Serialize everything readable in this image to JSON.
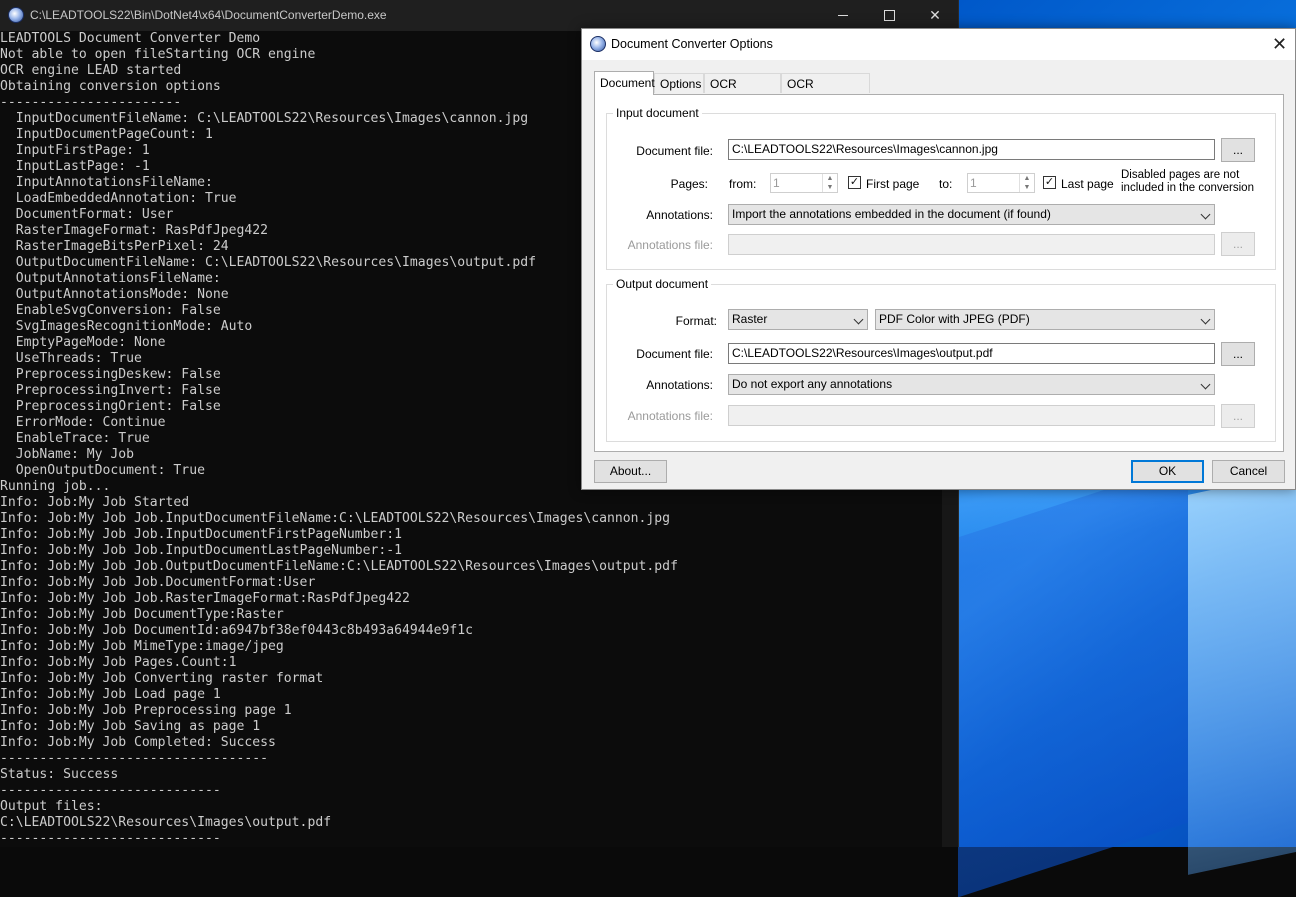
{
  "console": {
    "title": "C:\\LEADTOOLS22\\Bin\\DotNet4\\x64\\DocumentConverterDemo.exe",
    "lines": [
      "LEADTOOLS Document Converter Demo",
      "Not able to open fileStarting OCR engine",
      "OCR engine LEAD started",
      "Obtaining conversion options",
      "-----------------------",
      "  InputDocumentFileName: C:\\LEADTOOLS22\\Resources\\Images\\cannon.jpg",
      "  InputDocumentPageCount: 1",
      "  InputFirstPage: 1",
      "  InputLastPage: -1",
      "  InputAnnotationsFileName:",
      "  LoadEmbeddedAnnotation: True",
      "  DocumentFormat: User",
      "  RasterImageFormat: RasPdfJpeg422",
      "  RasterImageBitsPerPixel: 24",
      "  OutputDocumentFileName: C:\\LEADTOOLS22\\Resources\\Images\\output.pdf",
      "  OutputAnnotationsFileName:",
      "  OutputAnnotationsMode: None",
      "  EnableSvgConversion: False",
      "  SvgImagesRecognitionMode: Auto",
      "  EmptyPageMode: None",
      "  UseThreads: True",
      "  PreprocessingDeskew: False",
      "  PreprocessingInvert: False",
      "  PreprocessingOrient: False",
      "  ErrorMode: Continue",
      "  EnableTrace: True",
      "  JobName: My Job",
      "  OpenOutputDocument: True",
      "Running job...",
      "Info: Job:My Job Started",
      "Info: Job:My Job Job.InputDocumentFileName:C:\\LEADTOOLS22\\Resources\\Images\\cannon.jpg",
      "Info: Job:My Job Job.InputDocumentFirstPageNumber:1",
      "Info: Job:My Job Job.InputDocumentLastPageNumber:-1",
      "Info: Job:My Job Job.OutputDocumentFileName:C:\\LEADTOOLS22\\Resources\\Images\\output.pdf",
      "Info: Job:My Job Job.DocumentFormat:User",
      "Info: Job:My Job Job.RasterImageFormat:RasPdfJpeg422",
      "Info: Job:My Job DocumentType:Raster",
      "Info: Job:My Job DocumentId:a6947bf38ef0443c8b493a64944e9f1c",
      "Info: Job:My Job MimeType:image/jpeg",
      "Info: Job:My Job Pages.Count:1",
      "Info: Job:My Job Converting raster format",
      "Info: Job:My Job Load page 1",
      "Info: Job:My Job Preprocessing page 1",
      "Info: Job:My Job Saving as page 1",
      "Info: Job:My Job Completed: Success",
      "----------------------------------",
      "Status: Success",
      "----------------------------",
      "Output files:",
      "C:\\LEADTOOLS22\\Resources\\Images\\output.pdf",
      "----------------------------"
    ]
  },
  "dialog": {
    "title": "Document Converter Options",
    "tabs": [
      "Document",
      "Options",
      "OCR Settings",
      "OCR Languages"
    ],
    "input": {
      "group_label": "Input document",
      "doc_file_label": "Document file:",
      "doc_file_value": "C:\\LEADTOOLS22\\Resources\\Images\\cannon.jpg",
      "browse_label": "...",
      "pages_label": "Pages:",
      "from_label": "from:",
      "from_value": "1",
      "first_page_label": "First page",
      "first_page_checked": true,
      "to_label": "to:",
      "to_value": "1",
      "last_page_label": "Last page",
      "last_page_checked": true,
      "note_line1": "Disabled pages are not",
      "note_line2": "included in the conversion",
      "annotations_label": "Annotations:",
      "annotations_value": "Import the annotations embedded in the document (if found)",
      "annotations_file_label": "Annotations file:",
      "annotations_file_value": ""
    },
    "output": {
      "group_label": "Output document",
      "format_label": "Format:",
      "format_value": "Raster",
      "subformat_value": "PDF Color with JPEG (PDF)",
      "doc_file_label": "Document file:",
      "doc_file_value": "C:\\LEADTOOLS22\\Resources\\Images\\output.pdf",
      "browse_label": "...",
      "annotations_label": "Annotations:",
      "annotations_value": "Do not export any annotations",
      "annotations_file_label": "Annotations file:",
      "annotations_file_value": ""
    },
    "about_label": "About...",
    "ok_label": "OK",
    "cancel_label": "Cancel"
  }
}
